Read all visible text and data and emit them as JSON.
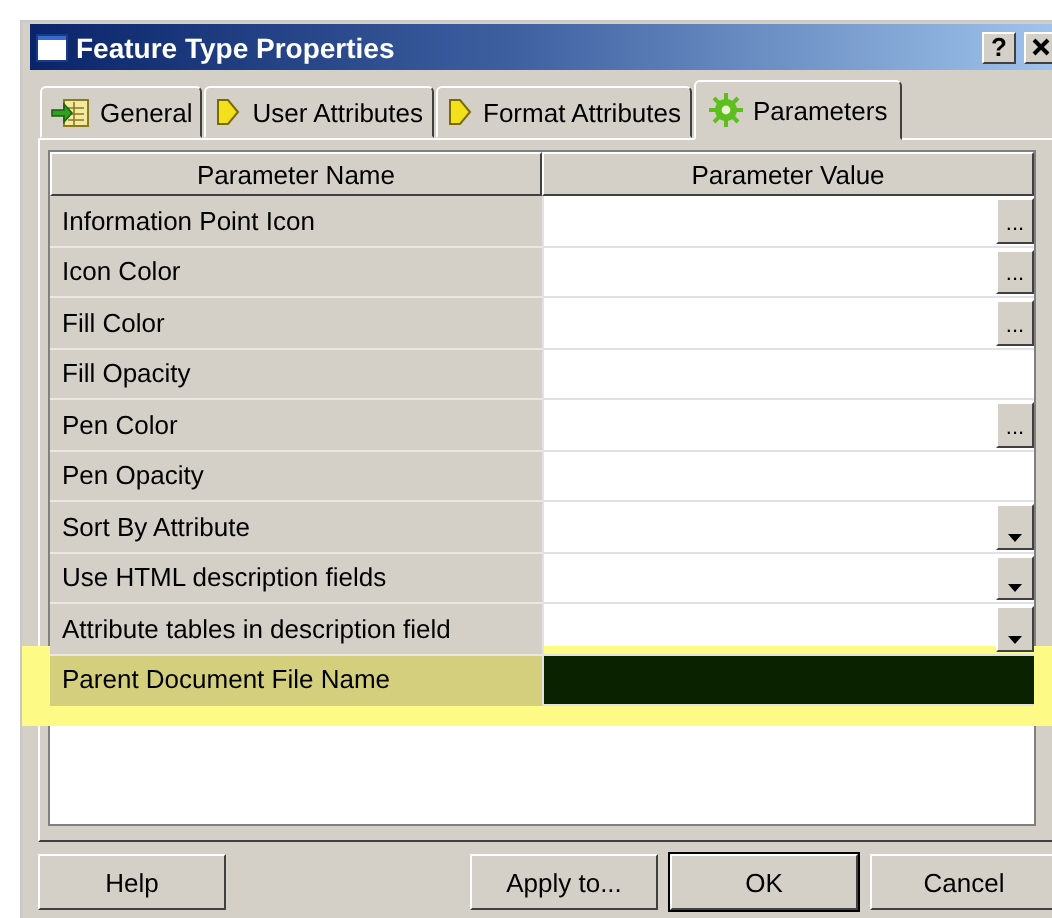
{
  "window": {
    "title": "Feature Type Properties",
    "help_button": "?"
  },
  "tabs": [
    {
      "label": "General",
      "kind": "general",
      "selected": false
    },
    {
      "label": "User Attributes",
      "kind": "attribute",
      "selected": false
    },
    {
      "label": "Format Attributes",
      "kind": "attribute",
      "selected": false
    },
    {
      "label": "Parameters",
      "kind": "gear",
      "selected": true
    }
  ],
  "table": {
    "columns": [
      "Parameter Name",
      "Parameter Value"
    ],
    "rows": [
      {
        "name": "Information Point Icon",
        "kind": "ellipsis",
        "button": "...",
        "selected": false,
        "highlighted": false
      },
      {
        "name": "Icon Color",
        "kind": "ellipsis",
        "button": "...",
        "selected": false,
        "highlighted": false
      },
      {
        "name": "Fill Color",
        "kind": "ellipsis",
        "button": "...",
        "selected": false,
        "highlighted": false
      },
      {
        "name": "Fill Opacity",
        "kind": "plain",
        "selected": false,
        "highlighted": false
      },
      {
        "name": "Pen Color",
        "kind": "ellipsis",
        "button": "...",
        "selected": false,
        "highlighted": false
      },
      {
        "name": "Pen Opacity",
        "kind": "plain",
        "selected": false,
        "highlighted": false
      },
      {
        "name": "Sort By Attribute",
        "kind": "dropdown",
        "selected": false,
        "highlighted": false
      },
      {
        "name": "Use HTML description fields",
        "kind": "dropdown",
        "selected": false,
        "highlighted": false
      },
      {
        "name": "Attribute tables in description field",
        "kind": "dropdown",
        "selected": false,
        "highlighted": false
      },
      {
        "name": "Parent Document File Name",
        "kind": "plain",
        "selected": true,
        "highlighted": true
      }
    ]
  },
  "buttons": [
    {
      "label": "Help",
      "default": false
    },
    {
      "label": "Apply to...",
      "default": false
    },
    {
      "label": "OK",
      "default": true
    },
    {
      "label": "Cancel",
      "default": false
    }
  ]
}
